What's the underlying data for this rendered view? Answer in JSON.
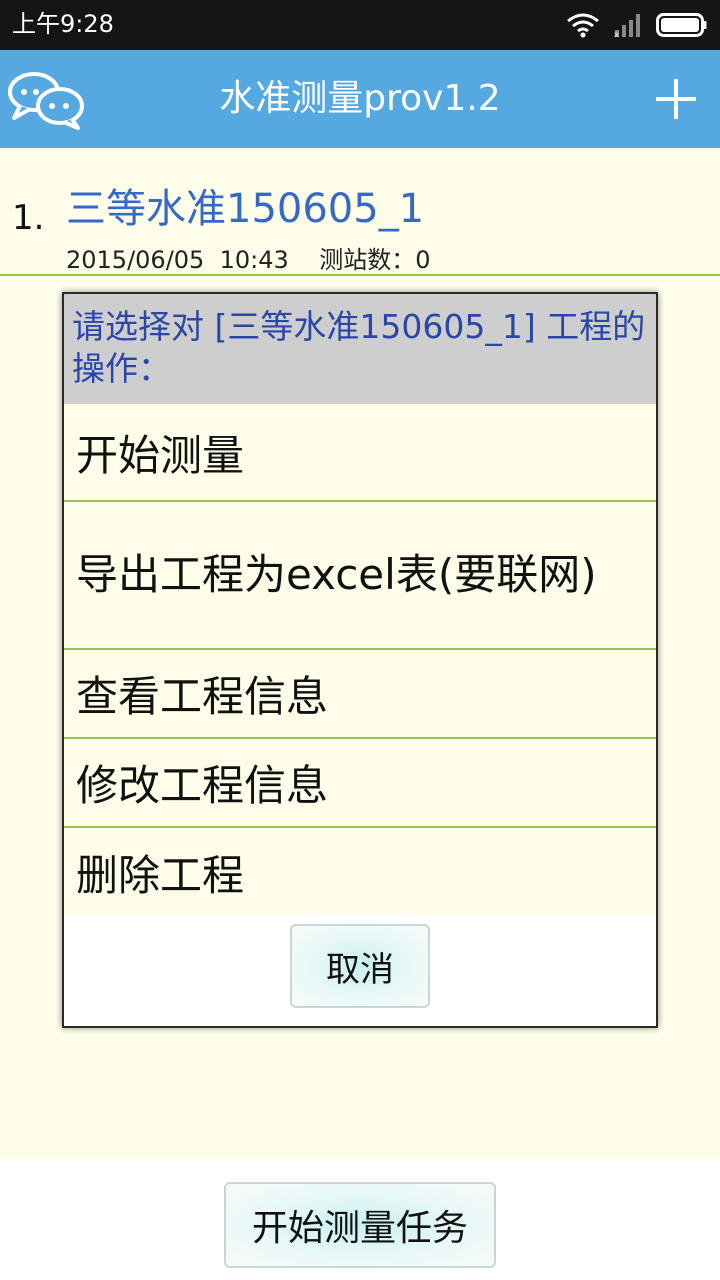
{
  "status_bar": {
    "time": "上午9:28",
    "icons": [
      "wifi-icon",
      "signal-icon",
      "battery-icon"
    ]
  },
  "action_bar": {
    "title": "水准测量prov1.2",
    "left_icon": "chat-bubbles-icon",
    "right_icon": "add-icon"
  },
  "project_list": [
    {
      "index": "1.",
      "title": "三等水准150605_1",
      "meta": "2015/06/05  10:43    测站数：0"
    }
  ],
  "dialog": {
    "header": "请选择对 [三等水准150605_1] 工程的操作：",
    "items": [
      {
        "label": "开始测量"
      },
      {
        "label": "导出工程为excel表(要联网)"
      },
      {
        "label": "查看工程信息"
      },
      {
        "label": "修改工程信息"
      },
      {
        "label": "删除工程"
      }
    ],
    "cancel_label": "取消"
  },
  "bottom": {
    "start_task_label": "开始测量任务"
  },
  "colors": {
    "status_bar": "#151515",
    "action_bar": "#55a9e0",
    "content_bg": "#fdfdea",
    "divider": "#99c34a",
    "link_blue": "#3568c7",
    "dialog_header_bg": "#cecece",
    "dialog_header_text": "#2a46a8"
  }
}
